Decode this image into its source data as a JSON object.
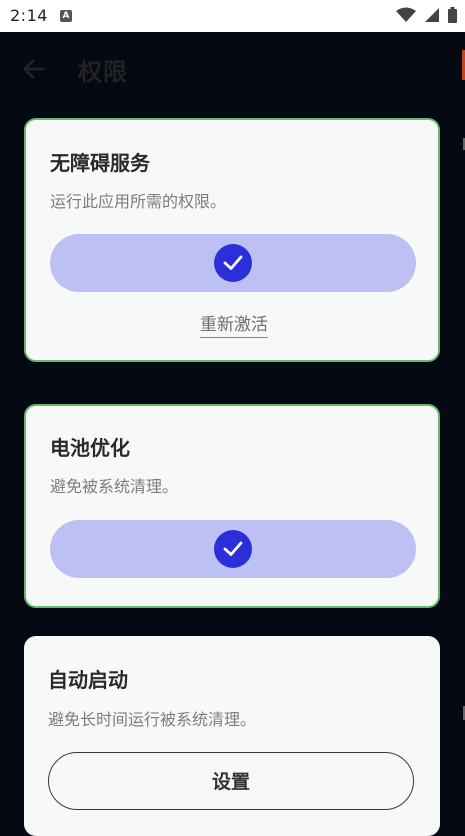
{
  "status_bar": {
    "time": "2:14",
    "notification_icon": "a-icon",
    "right_icons": [
      "wifi-icon",
      "signal-icon",
      "battery-icon"
    ]
  },
  "app_bar": {
    "title": "权限",
    "back_icon": "arrow-left-icon"
  },
  "permissions": [
    {
      "title": "无障碍服务",
      "description": "运行此应用所需的权限。",
      "granted": true,
      "action_label": "重新激活"
    },
    {
      "title": "电池优化",
      "description": "避免被系统清理。",
      "granted": true
    },
    {
      "title": "自动启动",
      "description": "避免长时间运行被系统清理。",
      "granted": false,
      "button_label": "设置"
    }
  ],
  "colors": {
    "background": "#050914",
    "card": "#f7f9f8",
    "granted_border": "#6bb86a",
    "pill": "#bcc0f3",
    "check": "#2b2fd9"
  }
}
